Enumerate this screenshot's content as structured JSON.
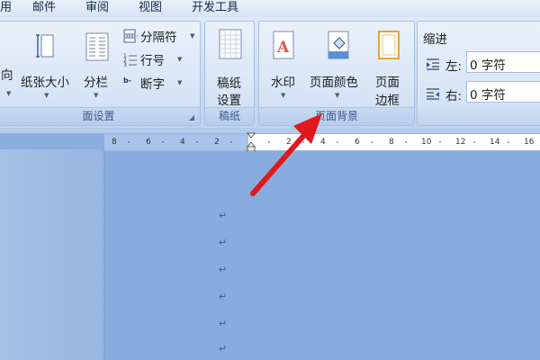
{
  "menubar": {
    "items": [
      "用",
      "邮件",
      "审阅",
      "视图",
      "开发工具"
    ]
  },
  "page_setup": {
    "orientation_label": "向",
    "size_label": "纸张大小",
    "columns_label": "分栏",
    "separator_label": "分隔符",
    "line_numbers_label": "行号",
    "hyphenation_label": "断字",
    "group_label": "面设置"
  },
  "manuscript": {
    "button_label_line1": "稿纸",
    "button_label_line2": "设置",
    "group_label": "稿纸"
  },
  "page_background": {
    "watermark_label": "水印",
    "page_color_label": "页面颜色",
    "page_border_line1": "页面",
    "page_border_line2": "边框",
    "group_label": "页面背景"
  },
  "indent": {
    "title": "缩进",
    "left_label": "左:",
    "left_value": "0 字符",
    "right_label": "右:",
    "right_value": "0 字符"
  },
  "ruler": {
    "ticks": [
      "8",
      "6",
      "4",
      "2",
      "2",
      "4",
      "6",
      "8",
      "10",
      "12",
      "14",
      "16"
    ]
  },
  "document": {
    "paragraph_mark": "↵"
  },
  "colors": {
    "page_background": "#89acdf",
    "annotation_arrow": "#e0191c"
  },
  "icons": {
    "orientation": "orientation-icon",
    "size": "paper-size-icon",
    "columns": "columns-icon",
    "separator": "break-icon",
    "line_numbers": "line-numbers-icon",
    "hyphenation": "hyphenation-icon",
    "manuscript": "manuscript-icon",
    "watermark": "watermark-icon",
    "page_color": "page-color-icon",
    "page_border": "page-border-icon",
    "indent_left": "indent-left-icon",
    "indent_right": "indent-right-icon"
  }
}
